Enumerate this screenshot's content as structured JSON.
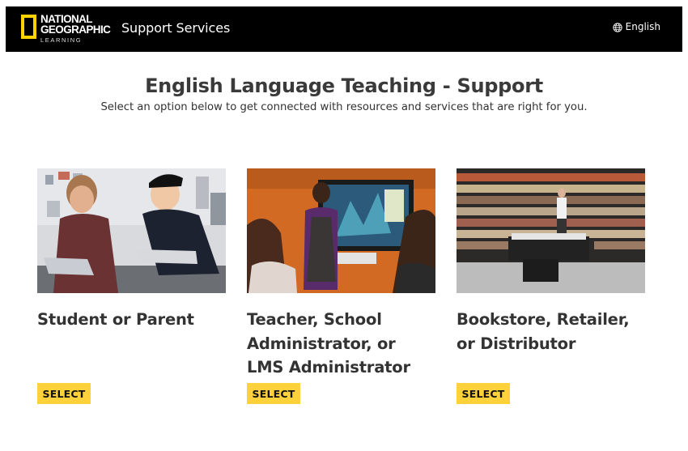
{
  "header": {
    "logo": {
      "line1": "NATIONAL",
      "line2": "GEOGRAPHIC",
      "line3": "LEARNING"
    },
    "title": "Support Services",
    "language_label": "English"
  },
  "main": {
    "title": "English Language Teaching - Support",
    "subtitle": "Select an option below to get connected with resources and services that are right for you."
  },
  "cards": [
    {
      "title": "Student or Parent",
      "button_label": "SELECT"
    },
    {
      "title": "Teacher, School Administrator, or LMS Administrator",
      "button_label": "SELECT"
    },
    {
      "title": "Bookstore, Retailer, or Distributor",
      "button_label": "SELECT"
    }
  ],
  "colors": {
    "header_bg": "#000000",
    "brand_yellow": "#FFD200",
    "button_yellow": "#FFD13B"
  },
  "icons": {
    "language": "globe-icon"
  }
}
